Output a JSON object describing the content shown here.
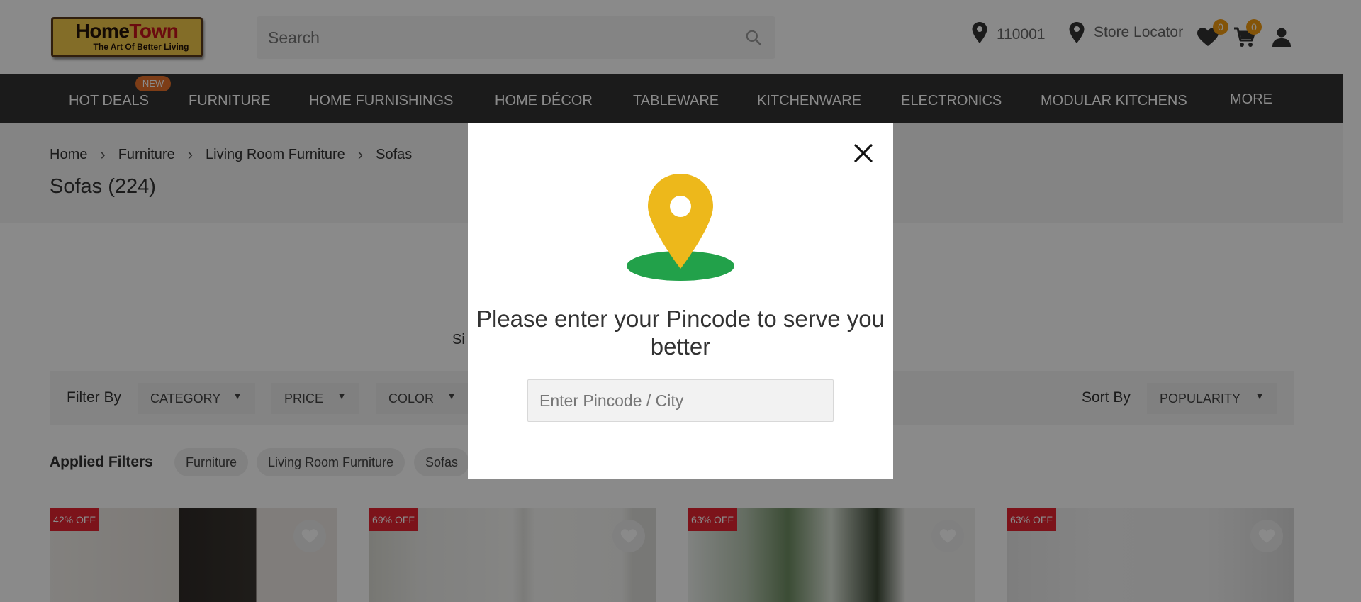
{
  "header": {
    "logo_main_a": "Home",
    "logo_main_b": "Town",
    "logo_sub": "The Art Of Better Living",
    "search_placeholder": "Search",
    "pincode": "110001",
    "store_locator": "Store Locator",
    "wishlist_count": "0",
    "cart_count": "0"
  },
  "nav": {
    "items": [
      "HOT DEALS",
      "FURNITURE",
      "HOME FURNISHINGS",
      "HOME DÉCOR",
      "TABLEWARE",
      "KITCHENWARE",
      "ELECTRONICS",
      "MODULAR KITCHENS",
      "MORE"
    ],
    "new_badge": "NEW"
  },
  "breadcrumb": [
    "Home",
    "Furniture",
    "Living Room Furniture",
    "Sofas"
  ],
  "page_title": "Sofas (224)",
  "partial_text": "Si",
  "filters": {
    "filter_by": "Filter By",
    "dropdowns": [
      "CATEGORY",
      "PRICE",
      "COLOR"
    ],
    "sort_by": "Sort By",
    "sort_value": "POPULARITY"
  },
  "applied": {
    "label": "Applied Filters",
    "chips": [
      "Furniture",
      "Living Room Furniture",
      "Sofas"
    ]
  },
  "products": [
    {
      "discount": "42% OFF"
    },
    {
      "discount": "69% OFF"
    },
    {
      "discount": "63% OFF"
    },
    {
      "discount": "63% OFF"
    }
  ],
  "modal": {
    "title": "Please enter your Pincode to serve you better",
    "input_placeholder": "Enter Pincode / City"
  },
  "colors": {
    "pin_yellow": "#EDB81B",
    "ground_green": "#22A14A",
    "nav_bg": "#333333",
    "badge_orange": "#F39C12",
    "discount_red": "#E52330"
  }
}
